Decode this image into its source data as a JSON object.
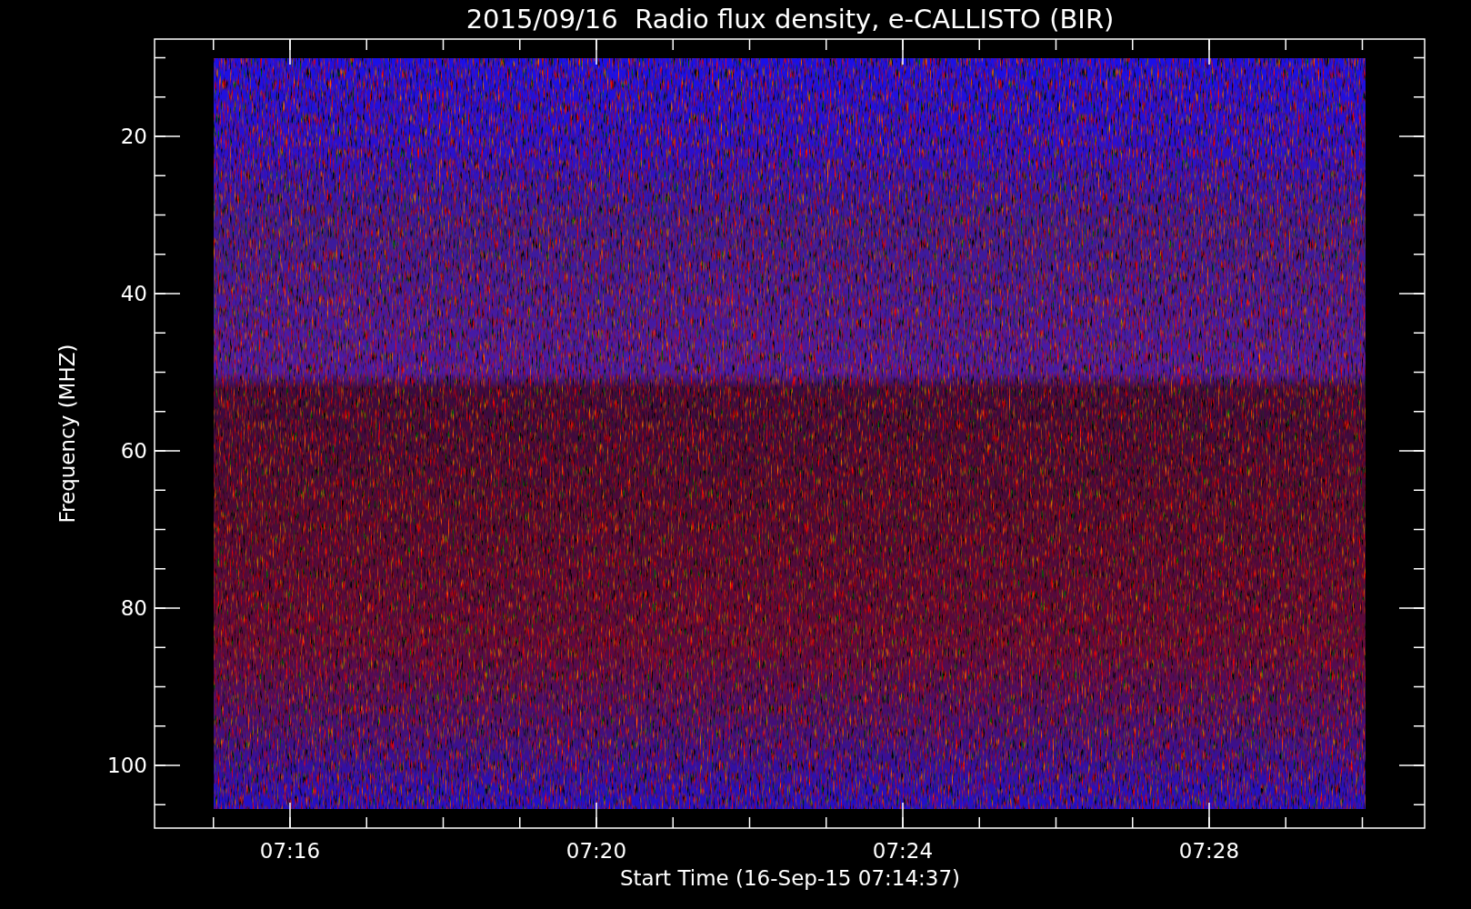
{
  "title": "2015/09/16  Radio flux density, e-CALLISTO (BIR)",
  "y_axis": {
    "label": "Frequency (MHZ)",
    "ticks": [
      "20",
      "40",
      "60",
      "80",
      "100"
    ]
  },
  "x_axis": {
    "label": "Start Time (16-Sep-15 07:14:37)",
    "ticks": [
      "07:16",
      "07:20",
      "07:24",
      "07:28"
    ]
  }
}
